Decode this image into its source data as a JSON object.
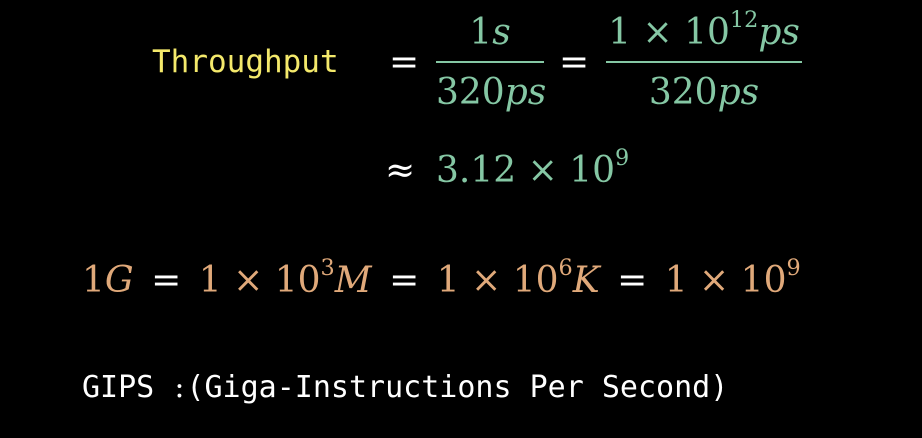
{
  "colors": {
    "background": "#000000",
    "label_yellow": "#f4e96b",
    "teal": "#85c7a4",
    "orange": "#e0a97a",
    "white": "#ffffff"
  },
  "equation1": {
    "label": "Throughput",
    "eq": "=",
    "frac1": {
      "num_value": "1",
      "num_unit": "s",
      "den_value": "320",
      "den_unit": "ps"
    },
    "eq2": "=",
    "frac2": {
      "num_value": "1",
      "num_times": "×",
      "num_base": "10",
      "num_exp": "12",
      "num_unit": "ps",
      "den_value": "320",
      "den_unit": "ps"
    }
  },
  "equation2": {
    "approx": "≈",
    "value": "3.12",
    "times": "×",
    "base": "10",
    "exp": "9"
  },
  "equation3": {
    "g_value": "1",
    "g_unit": "G",
    "eq1": "=",
    "m_coef": "1",
    "m_times": "×",
    "m_base": "10",
    "m_exp": "3",
    "m_unit": "M",
    "eq2": "=",
    "k_coef": "1",
    "k_times": "×",
    "k_base": "10",
    "k_exp": "6",
    "k_unit": "K",
    "eq3": "=",
    "end_coef": "1",
    "end_times": "×",
    "end_base": "10",
    "end_exp": "9"
  },
  "gips": {
    "label": "GIPS",
    "colon": ":",
    "description": "(Giga-Instructions Per Second)"
  }
}
